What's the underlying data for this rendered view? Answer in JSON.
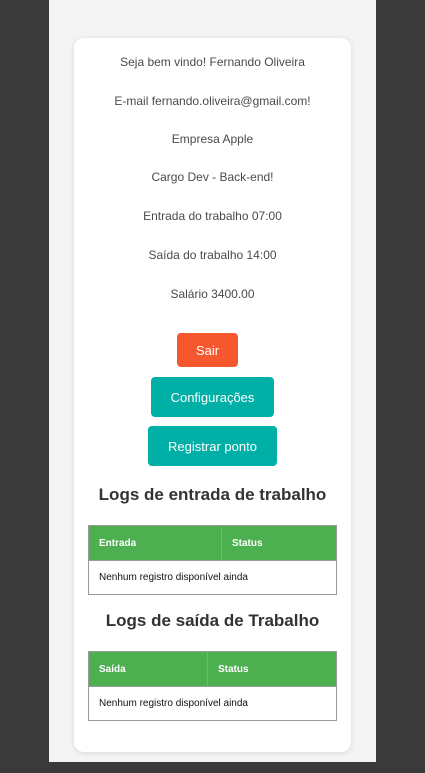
{
  "profile": {
    "welcome": "Seja bem vindo! Fernando Oliveira",
    "email": "E-mail fernando.oliveira@gmail.com!",
    "company": "Empresa Apple",
    "role": "Cargo Dev - Back-end!",
    "entry_time": "Entrada do trabalho 07:00",
    "exit_time": "Saída do trabalho 14:00",
    "salary": "Salário 3400.00"
  },
  "actions": {
    "exit_label": "Sair",
    "settings_label": "Configurações",
    "register_label": "Registrar ponto"
  },
  "entry_logs": {
    "title": "Logs de entrada de trabalho",
    "columns": [
      "Entrada",
      "Status"
    ],
    "empty_message": "Nenhum registro disponível ainda"
  },
  "exit_logs": {
    "title": "Logs de saída de Trabalho",
    "columns": [
      "Saída",
      "Status"
    ],
    "empty_message": "Nenhum registro disponível ainda"
  },
  "colors": {
    "page_background": "#3a3a3a",
    "exit_button": "#f5582f",
    "primary_button": "#00b0a6",
    "table_header": "#4caf50"
  }
}
